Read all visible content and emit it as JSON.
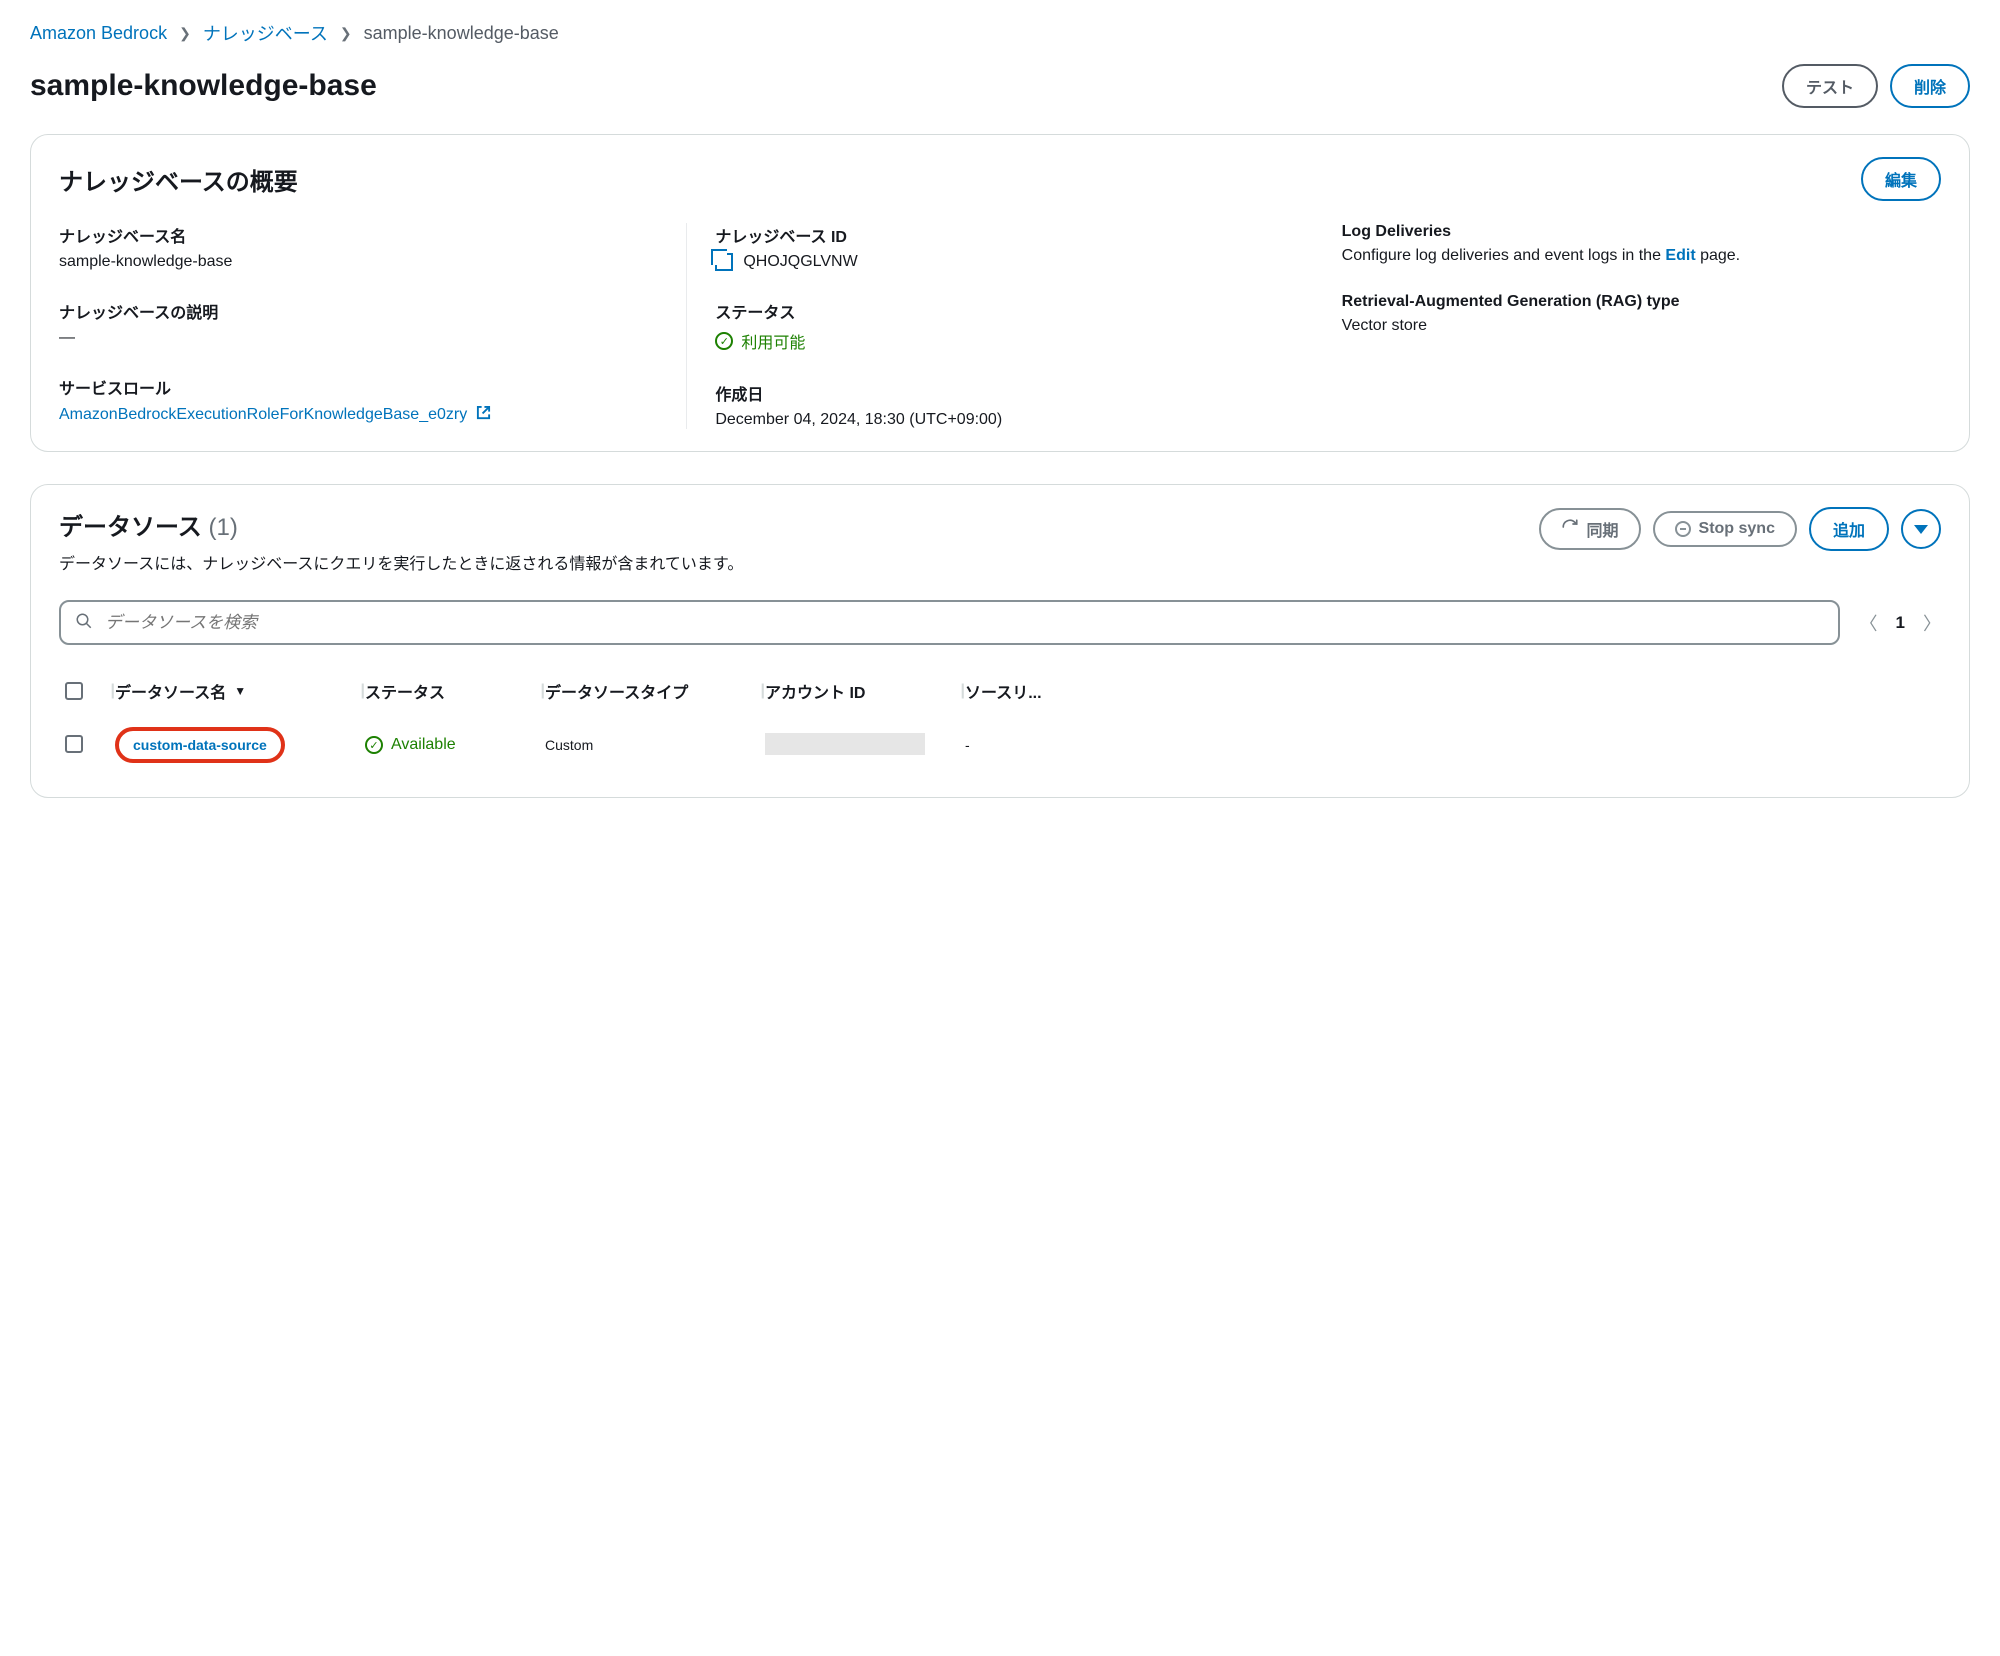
{
  "breadcrumb": {
    "root": "Amazon Bedrock",
    "section": "ナレッジベース",
    "current": "sample-knowledge-base"
  },
  "header": {
    "title": "sample-knowledge-base",
    "test_btn": "テスト",
    "delete_btn": "削除"
  },
  "overview": {
    "panel_title": "ナレッジベースの概要",
    "edit_btn": "編集",
    "name_label": "ナレッジベース名",
    "name_value": "sample-knowledge-base",
    "desc_label": "ナレッジベースの説明",
    "desc_value": "—",
    "role_label": "サービスロール",
    "role_value": "AmazonBedrockExecutionRoleForKnowledgeBase_e0zry",
    "id_label": "ナレッジベース ID",
    "id_value": "QHOJQGLVNW",
    "status_label": "ステータス",
    "status_value": "利用可能",
    "created_label": "作成日",
    "created_value": "December 04, 2024, 18:30 (UTC+09:00)",
    "log_label": "Log Deliveries",
    "log_text_pre": "Configure log deliveries and event logs in the ",
    "log_link": "Edit",
    "log_text_post": " page.",
    "rag_label": "Retrieval-Augmented Generation (RAG) type",
    "rag_value": "Vector store"
  },
  "datasource": {
    "title": "データソース",
    "count": "(1)",
    "desc": "データソースには、ナレッジベースにクエリを実行したときに返される情報が含まれています。",
    "sync_btn": "同期",
    "stop_btn": "Stop sync",
    "add_btn": "追加",
    "search_placeholder": "データソースを検索",
    "page_num": "1",
    "columns": {
      "name": "データソース名",
      "status": "ステータス",
      "type": "データソースタイプ",
      "account": "アカウント ID",
      "source": "ソースリ..."
    },
    "rows": [
      {
        "name": "custom-data-source",
        "status": "Available",
        "type": "Custom",
        "source": "-"
      }
    ]
  }
}
